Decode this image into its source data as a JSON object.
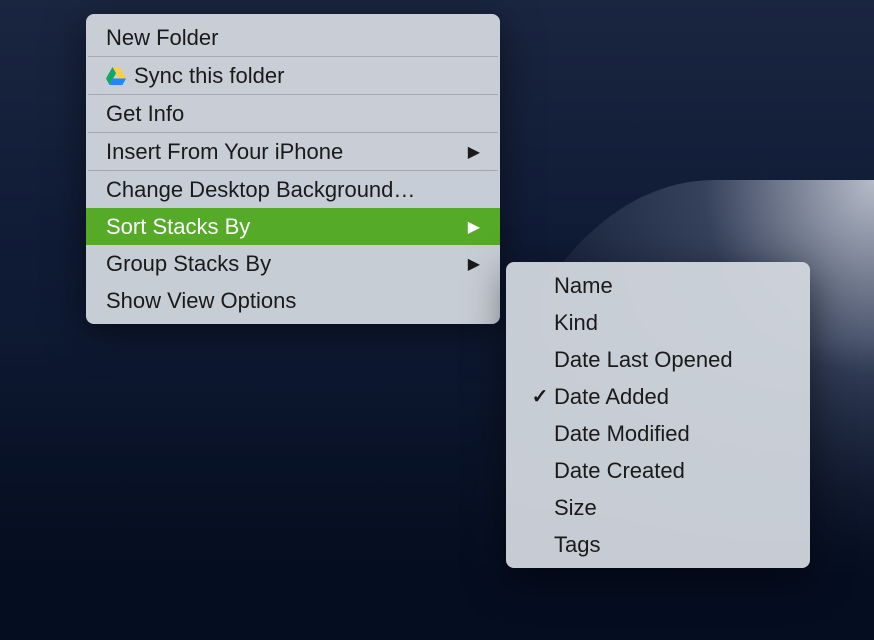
{
  "main_menu": {
    "items": [
      {
        "label": "New Folder",
        "icon": null,
        "submenu": false
      },
      {
        "label": "Sync this folder",
        "icon": "drive",
        "submenu": false
      },
      {
        "label": "Get Info",
        "icon": null,
        "submenu": false
      },
      {
        "label": "Insert From Your iPhone",
        "icon": null,
        "submenu": true
      },
      {
        "label": "Change Desktop Background…",
        "icon": null,
        "submenu": false
      },
      {
        "label": "Sort Stacks By",
        "icon": null,
        "submenu": true,
        "selected": true
      },
      {
        "label": "Group Stacks By",
        "icon": null,
        "submenu": true
      },
      {
        "label": "Show View Options",
        "icon": null,
        "submenu": false
      }
    ]
  },
  "submenu": {
    "items": [
      {
        "label": "Name",
        "checked": false
      },
      {
        "label": "Kind",
        "checked": false
      },
      {
        "label": "Date Last Opened",
        "checked": false
      },
      {
        "label": "Date Added",
        "checked": true
      },
      {
        "label": "Date Modified",
        "checked": false
      },
      {
        "label": "Date Created",
        "checked": false
      },
      {
        "label": "Size",
        "checked": false
      },
      {
        "label": "Tags",
        "checked": false
      }
    ]
  },
  "arrow_glyph": "▶",
  "check_glyph": "✓"
}
